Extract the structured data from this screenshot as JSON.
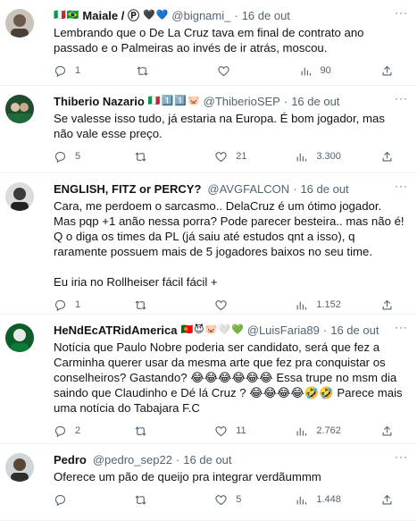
{
  "tweets": [
    {
      "name": "Maiale / Ⓟ",
      "badges": [
        "🇮🇹",
        "🇧🇷"
      ],
      "badges_after": [
        "🖤",
        "💙"
      ],
      "handle": "@bignami_",
      "time": "16 de out",
      "text": "Lembrando que o De La Cruz tava em final de contrato ano passado e o Palmeiras ao invés de ir atrás, moscou.",
      "replies": "1",
      "retweets": "",
      "likes": "",
      "views": "90"
    },
    {
      "name": "Thiberio Nazario",
      "badges": [],
      "badges_after": [
        "🇮🇹",
        "1️⃣",
        "1️⃣",
        "🐷"
      ],
      "handle": "@ThiberioSEP",
      "time": "16 de out",
      "text": "Se valesse isso tudo, já estaria na Europa. É bom jogador, mas não vale esse preço.",
      "replies": "5",
      "retweets": "",
      "likes": "21",
      "views": "3.300"
    },
    {
      "name": "ENGLISH, FITZ or PERCY?",
      "badges": [],
      "badges_after": [],
      "handle": "@AVGFALCON",
      "time": "16 de out",
      "text": "Cara, me perdoem o sarcasmo.. DelaCruz é um ótimo jogador. Mas pqp +1 anão nessa porra? Pode parecer besteira.. mas não é! Q o diga os times da PL (já saiu até estudos qnt a isso), q raramente possuem mais de 5 jogadores baixos no seu time.\n\nEu iria no Rollheiser fácil fácil +",
      "replies": "1",
      "retweets": "",
      "likes": "",
      "views": "1.152"
    },
    {
      "name": "HeNdEcATRidAmerica",
      "badges": [],
      "badges_after": [
        "🇵🇹",
        "😈",
        "🐷",
        "🤍",
        "💚"
      ],
      "handle": "@LuisFaria89",
      "time": "16 de out",
      "text": "Notícia que Paulo Nobre poderia ser candidato, será que fez a Carminha querer usar da mesma arte que fez pra conquistar os conselheiros? Gastando? 😂😂😂😂😂😂 Essa trupe no msm dia saindo que Claudinho e Dé lá Cruz ? 😂😂😂😂🤣🤣 Parece mais uma notícia do Tabajara F.C",
      "replies": "2",
      "retweets": "",
      "likes": "11",
      "views": "2.762"
    },
    {
      "name": "Pedro",
      "badges": [],
      "badges_after": [],
      "handle": "@pedro_sep22",
      "time": "16 de out",
      "text": "Oferece um pão de queijo pra integrar verdãummm",
      "replies": "",
      "retweets": "",
      "likes": "5",
      "views": "1.448"
    }
  ],
  "icons": {
    "reply": "reply-icon",
    "retweet": "retweet-icon",
    "like": "like-icon",
    "views": "views-icon",
    "share": "share-icon",
    "more": "more-icon"
  },
  "colors": {
    "text": "#0f1419",
    "secondary": "#536471",
    "divider": "#eff3f4"
  }
}
